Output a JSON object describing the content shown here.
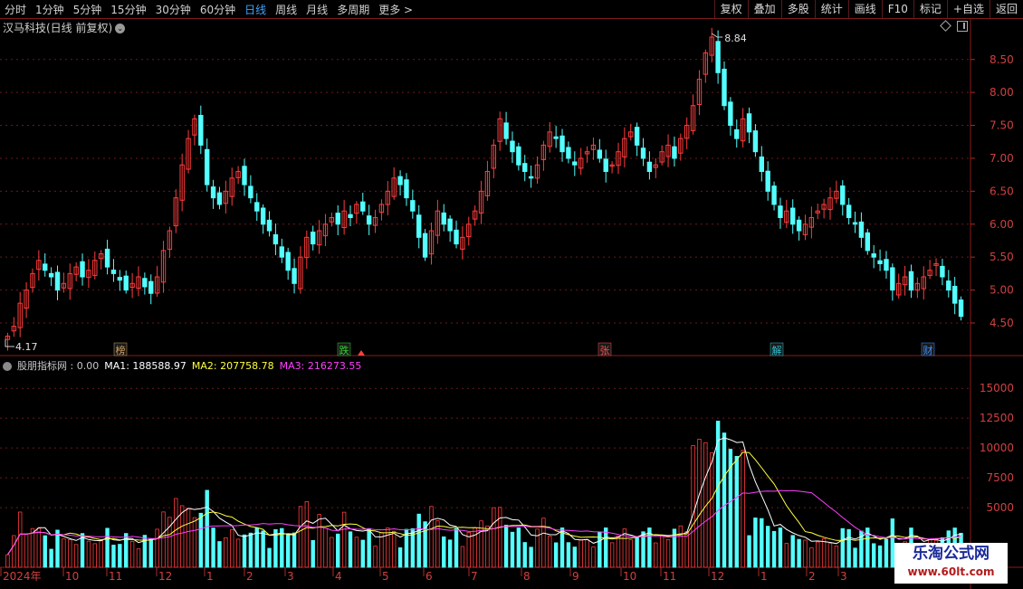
{
  "toolbar": {
    "timeframes": [
      {
        "label": "分时",
        "active": false
      },
      {
        "label": "1分钟",
        "active": false
      },
      {
        "label": "5分钟",
        "active": false
      },
      {
        "label": "15分钟",
        "active": false
      },
      {
        "label": "30分钟",
        "active": false
      },
      {
        "label": "60分钟",
        "active": false
      },
      {
        "label": "日线",
        "active": true
      },
      {
        "label": "周线",
        "active": false
      },
      {
        "label": "月线",
        "active": false
      },
      {
        "label": "多周期",
        "active": false
      },
      {
        "label": "更多 >",
        "active": false
      }
    ],
    "buttons": [
      "复权",
      "叠加",
      "多股",
      "统计",
      "画线",
      "F10",
      "标记",
      "+自选",
      "返回"
    ]
  },
  "stock": {
    "title": "汉马科技(日线 前复权)"
  },
  "price_axis": [
    "8.50",
    "8.00",
    "7.50",
    "7.00",
    "6.50",
    "6.00",
    "5.50",
    "5.00",
    "4.50"
  ],
  "annotations": {
    "high": "8.84",
    "low": "4.17"
  },
  "markers": [
    {
      "label": "榜",
      "color": "#d0a060"
    },
    {
      "label": "跌",
      "color": "#30d030"
    },
    {
      "label": "张",
      "color": "#ff5050"
    },
    {
      "label": "解",
      "color": "#30c0d0"
    },
    {
      "label": "财",
      "color": "#4090ff"
    }
  ],
  "indicator": {
    "name": "股朋指标网 : 0.00",
    "ma1": "MA1: 188588.97",
    "ma2": "MA2: 207758.78",
    "ma3": "MA3: 216273.55",
    "colors": {
      "ma1": "#ffffff",
      "ma2": "#ffff40",
      "ma3": "#ff40ff"
    },
    "axis": [
      "15000",
      "12500",
      "10000",
      "7500",
      "5000"
    ]
  },
  "date_axis": [
    "2024年",
    "10",
    "11",
    "12",
    "1",
    "2",
    "3",
    "4",
    "5",
    "6",
    "7",
    "8",
    "9",
    "10",
    "11",
    "12",
    "1",
    "2",
    "3"
  ],
  "watermark": {
    "line1": "乐淘公式网",
    "line2": "www.60lt.com"
  },
  "chart_data": {
    "type": "candlestick",
    "ylim": [
      4.17,
      8.84
    ],
    "ohlc_closes": [
      4.3,
      4.45,
      4.8,
      5.0,
      5.25,
      5.45,
      5.3,
      5.2,
      5.0,
      5.1,
      5.25,
      5.35,
      5.2,
      5.3,
      5.45,
      5.55,
      5.35,
      5.25,
      5.15,
      5.0,
      5.1,
      5.2,
      5.05,
      4.95,
      5.2,
      5.6,
      5.9,
      6.4,
      6.9,
      7.3,
      7.6,
      7.2,
      6.6,
      6.4,
      6.3,
      6.5,
      6.7,
      6.8,
      6.6,
      6.4,
      6.2,
      6.0,
      5.9,
      5.7,
      5.5,
      5.3,
      5.1,
      5.5,
      5.8,
      5.7,
      5.9,
      6.0,
      6.1,
      6.0,
      6.2,
      6.1,
      6.3,
      6.2,
      6.0,
      6.1,
      6.3,
      6.5,
      6.7,
      6.6,
      6.4,
      6.2,
      5.8,
      5.5,
      5.9,
      6.2,
      6.0,
      5.9,
      5.7,
      5.8,
      6.0,
      6.2,
      6.5,
      6.8,
      7.2,
      7.6,
      7.3,
      7.1,
      6.9,
      6.8,
      6.7,
      6.9,
      7.2,
      7.4,
      7.3,
      7.1,
      7.0,
      6.9,
      7.0,
      7.1,
      7.2,
      7.0,
      6.8,
      6.9,
      7.1,
      7.3,
      7.4,
      7.2,
      7.0,
      6.8,
      6.9,
      7.1,
      7.2,
      7.0,
      7.3,
      7.5,
      7.8,
      8.2,
      8.6,
      8.84,
      8.3,
      7.8,
      7.5,
      7.3,
      7.6,
      7.4,
      7.1,
      6.8,
      6.5,
      6.3,
      6.1,
      6.2,
      6.0,
      5.9,
      6.0,
      6.1,
      6.2,
      6.3,
      6.4,
      6.5,
      6.3,
      6.1,
      6.0,
      5.8,
      5.6,
      5.5,
      5.4,
      5.3,
      5.0,
      5.1,
      5.2,
      5.0,
      5.1,
      5.2,
      5.3,
      5.4,
      5.2,
      5.0,
      4.8,
      4.6
    ],
    "volume_max": 16000,
    "ma_lines": [
      "MA1",
      "MA2",
      "MA3"
    ]
  }
}
